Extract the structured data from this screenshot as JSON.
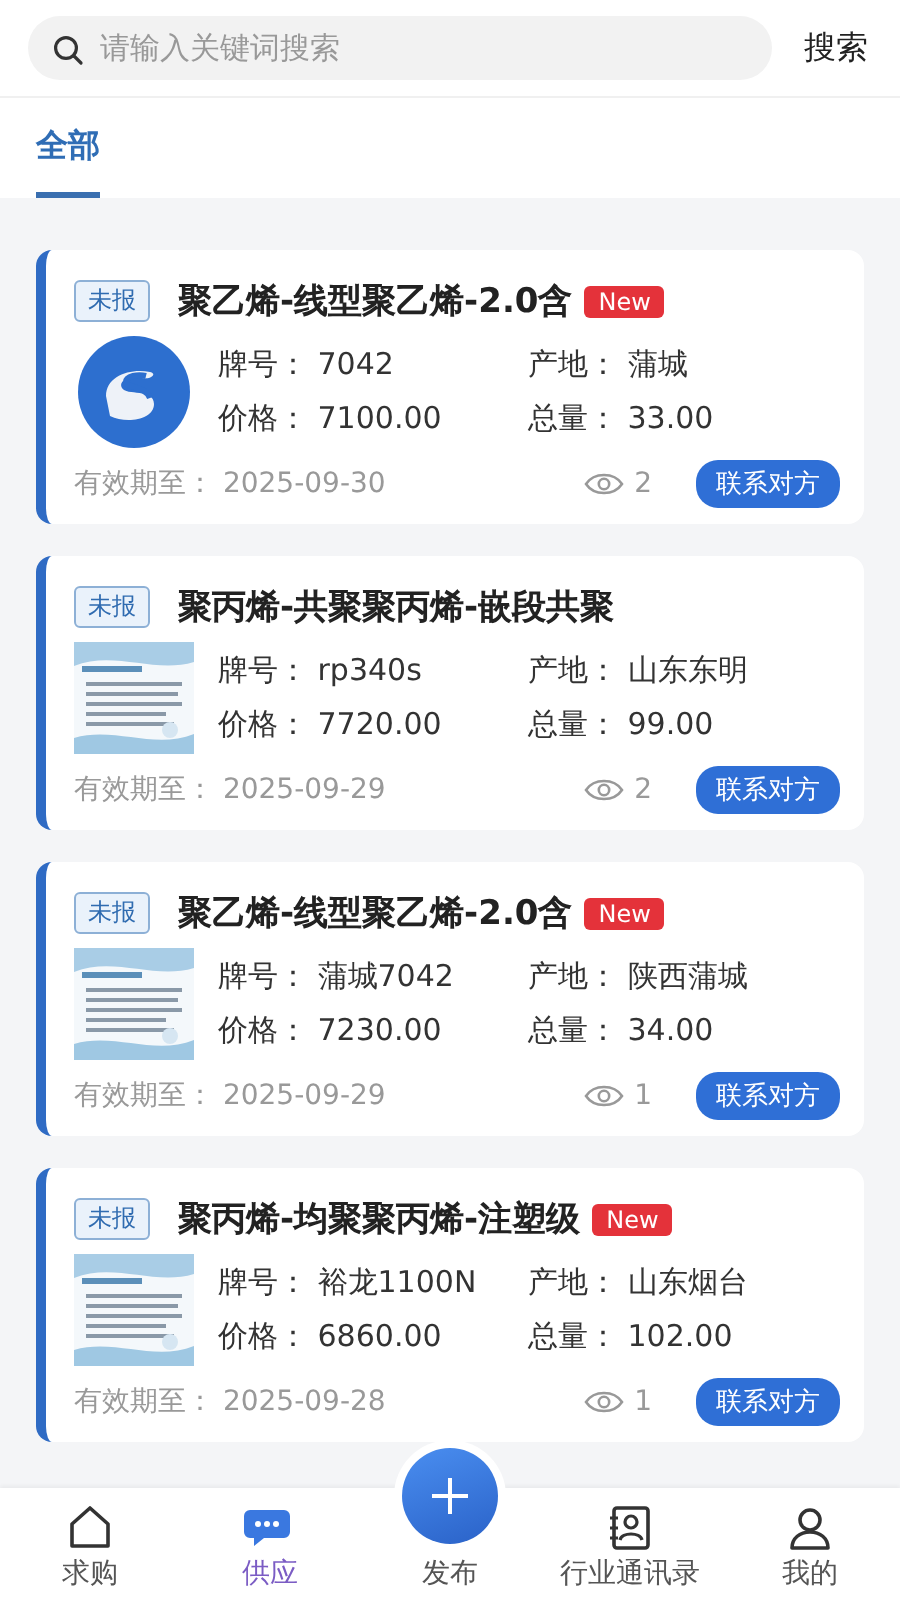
{
  "search": {
    "placeholder": "请输入关键词搜索",
    "button": "搜索"
  },
  "tabs": [
    {
      "label": "全部",
      "selected": true
    }
  ],
  "listings": [
    {
      "status": "未报",
      "title": "聚乙烯-线型聚乙烯-2.0含",
      "badge": "New",
      "image": {
        "kind": "logo"
      },
      "fields": [
        {
          "label": "牌号：",
          "value": "7042"
        },
        {
          "label": "产地：",
          "value": "蒲城"
        },
        {
          "label": "价格：",
          "value": "7100.00"
        },
        {
          "label": "总量：",
          "value": "33.00"
        }
      ],
      "expiry_label": "有效期至：",
      "expiry": "2025-09-30",
      "views": "2",
      "contact": "联系对方"
    },
    {
      "status": "未报",
      "title": "聚丙烯-共聚聚丙烯-嵌段共聚",
      "image": {
        "kind": "picture"
      },
      "fields": [
        {
          "label": "牌号：",
          "value": "rp340s"
        },
        {
          "label": "产地：",
          "value": "山东东明"
        },
        {
          "label": "价格：",
          "value": "7720.00"
        },
        {
          "label": "总量：",
          "value": "99.00"
        }
      ],
      "expiry_label": "有效期至：",
      "expiry": "2025-09-29",
      "views": "2",
      "contact": "联系对方"
    },
    {
      "status": "未报",
      "title": "聚乙烯-线型聚乙烯-2.0含",
      "badge": "New",
      "image": {
        "kind": "picture"
      },
      "fields": [
        {
          "label": "牌号：",
          "value": "蒲城7042"
        },
        {
          "label": "产地：",
          "value": "陕西蒲城"
        },
        {
          "label": "价格：",
          "value": "7230.00"
        },
        {
          "label": "总量：",
          "value": "34.00"
        }
      ],
      "expiry_label": "有效期至：",
      "expiry": "2025-09-29",
      "views": "1",
      "contact": "联系对方"
    },
    {
      "status": "未报",
      "title": "聚丙烯-均聚聚丙烯-注塑级",
      "badge": "New",
      "image": {
        "kind": "picture"
      },
      "fields": [
        {
          "label": "牌号：",
          "value": "裕龙1100N"
        },
        {
          "label": "产地：",
          "value": "山东烟台"
        },
        {
          "label": "价格：",
          "value": "6860.00"
        },
        {
          "label": "总量：",
          "value": "102.00"
        }
      ],
      "expiry_label": "有效期至：",
      "expiry": "2025-09-28",
      "views": "1",
      "contact": "联系对方"
    }
  ],
  "nav": [
    {
      "label": "求购",
      "kind": "tab",
      "selected": false
    },
    {
      "label": "供应",
      "kind": "tab",
      "selected": true
    },
    {
      "label": "发布",
      "kind": "add"
    },
    {
      "label": "行业通讯录",
      "kind": "tab",
      "selected": false
    },
    {
      "label": "我的",
      "kind": "tab",
      "selected": false
    }
  ]
}
